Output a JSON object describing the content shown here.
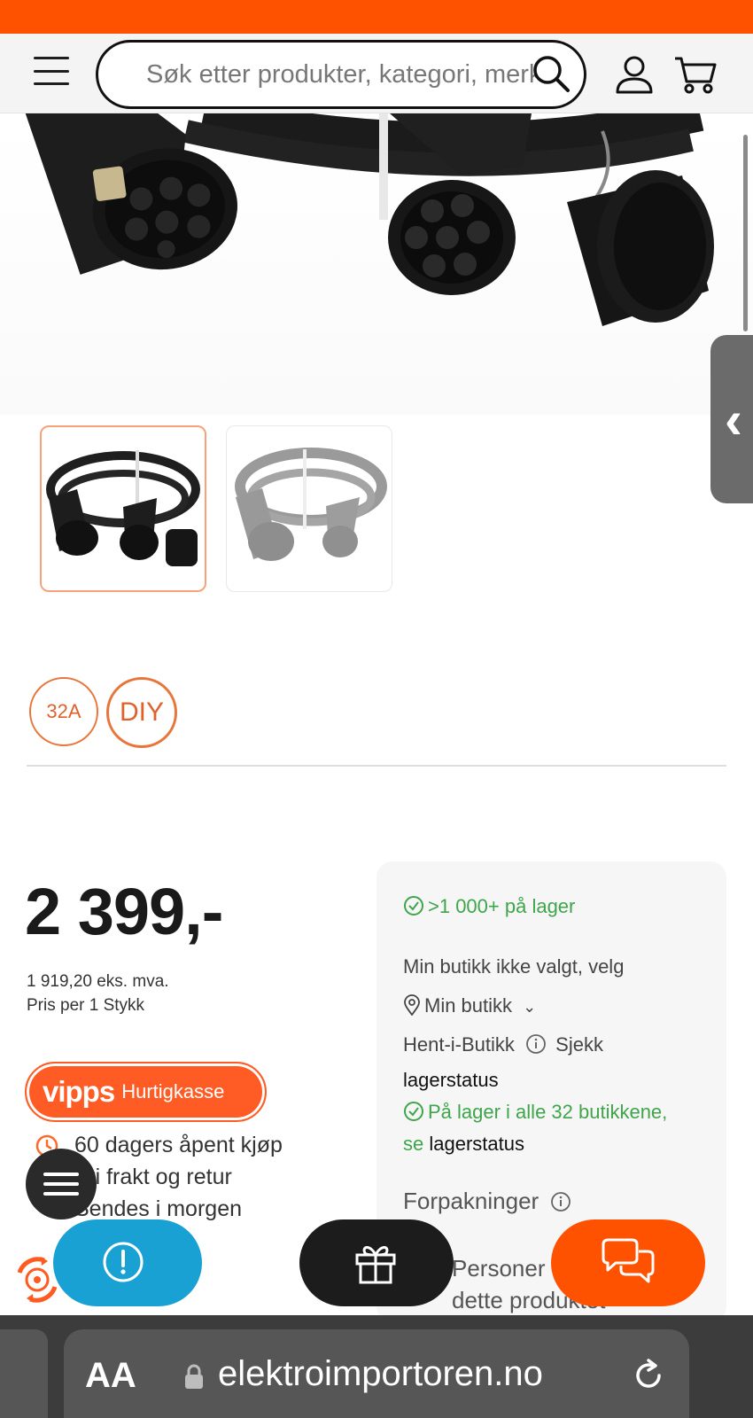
{
  "header": {
    "search_placeholder": "Søk etter produkter, kategori, merke"
  },
  "gallery": {
    "thumbnails": [
      "product-image-1",
      "product-image-2"
    ],
    "selected_index": 0
  },
  "badges": [
    "32A",
    "DIY"
  ],
  "price": {
    "main": "2 399,-",
    "ex_vat": "1 919,20 eks. mva.",
    "per_unit": "Pris per 1 Stykk"
  },
  "vipps": {
    "logo": "vipps",
    "label": "Hurtigkasse"
  },
  "usps": [
    "60 dagers åpent kjøp",
    "Fri frakt og retur",
    "Sendes i morgen"
  ],
  "stock": {
    "online": ">1 000+ på lager",
    "store_prompt": "Min butikk ikke valgt, velg",
    "my_store": "Min butikk",
    "pickup": "Hent-i-Butikk",
    "check": "Sjekk",
    "lagerstatus": "lagerstatus",
    "all_stores": "På lager i alle 32 butikkene,",
    "se": "se",
    "lagerstatus2": "lagerstatus",
    "packaging": "Forpakninger",
    "others_1": "Personer kjøpte",
    "others_2": "dette produktet"
  },
  "browser": {
    "aa": "AA",
    "url": "elektroimportoren.no"
  },
  "colors": {
    "brand_orange": "#ff5200",
    "stock_green": "#3ea54a",
    "alert_blue": "#1aa1d4"
  }
}
